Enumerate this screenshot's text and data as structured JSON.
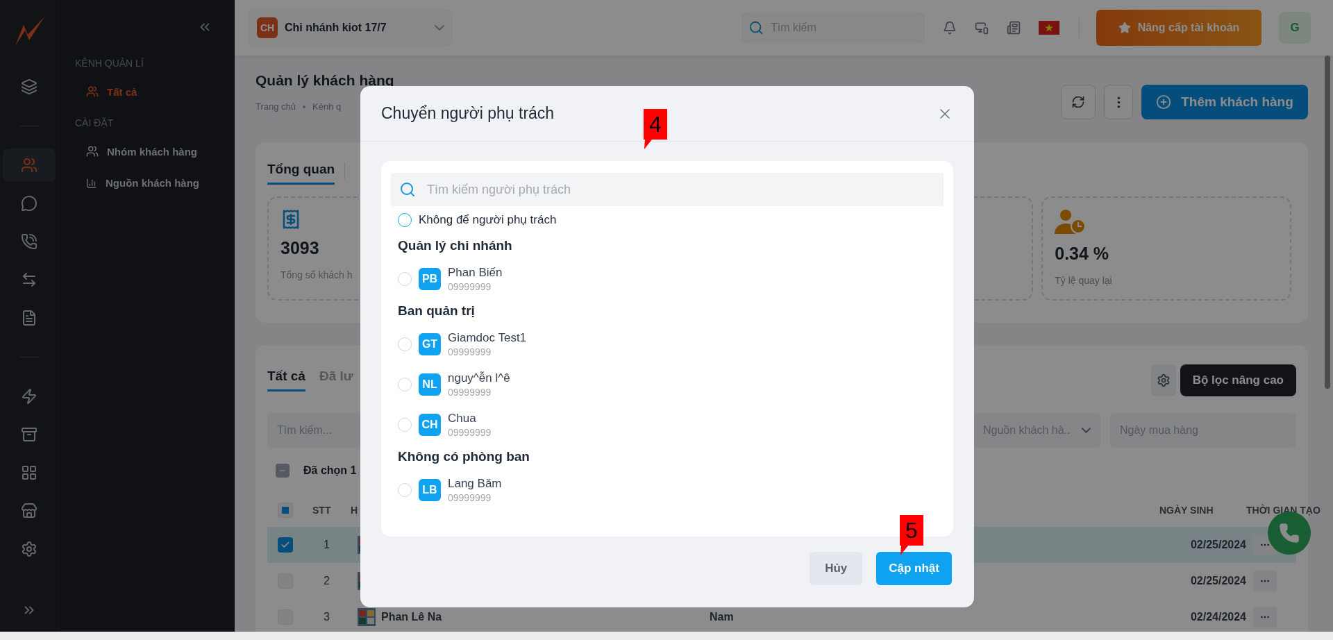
{
  "sidebar": {
    "rail": [
      {
        "kind": "layers",
        "selected": false
      },
      {
        "kind": "divider"
      },
      {
        "kind": "users",
        "selected": true
      },
      {
        "kind": "chat",
        "selected": false
      },
      {
        "kind": "phone",
        "selected": false
      },
      {
        "kind": "money",
        "selected": false
      },
      {
        "kind": "document",
        "selected": false
      },
      {
        "kind": "divider"
      },
      {
        "kind": "automation",
        "selected": false
      },
      {
        "kind": "archive",
        "selected": false
      },
      {
        "kind": "apps",
        "selected": false
      },
      {
        "kind": "store",
        "selected": false
      },
      {
        "kind": "settings",
        "selected": false
      }
    ],
    "sections": [
      {
        "title": "KÊNH QUẢN LÍ",
        "items": [
          {
            "label": "Tất cả",
            "kind": "users",
            "selected": true
          }
        ]
      },
      {
        "title": "CÀI ĐẶT",
        "items": [
          {
            "label": "Nhóm khách hàng",
            "kind": "users",
            "selected": false
          },
          {
            "label": "Nguồn khách hàng",
            "kind": "chart",
            "selected": false
          }
        ]
      }
    ]
  },
  "topbar": {
    "branch": {
      "badge": "CH",
      "name": "Chi nhánh kiot 17/7"
    },
    "search": {
      "placeholder": "Tìm kiếm"
    },
    "upgrade_button": "Nâng cấp tài khoản",
    "avatar": "G"
  },
  "page": {
    "title": "Quản lý khách hàng",
    "breadcrumb": [
      "Trang chủ",
      "Kênh q"
    ],
    "add_button": "Thêm khách hàng"
  },
  "overview": {
    "tabs": [
      {
        "label": "Tổng quan",
        "selected": true
      }
    ],
    "stats": [
      {
        "kind": "receipt",
        "value": "3093",
        "label": "Tổng số khách h"
      },
      {
        "kind": "blank"
      },
      {
        "kind": "returning",
        "value": "0.34 %",
        "label": "Tỷ lệ quay lại"
      }
    ]
  },
  "customers": {
    "tabs": [
      {
        "label": "Tất cả",
        "selected": true
      },
      {
        "label": "Đã lư",
        "selected": false
      }
    ],
    "filter_button": "Bộ lọc nâng cao",
    "filters": [
      {
        "kind": "search",
        "placeholder": "Tìm kiếm..."
      },
      {
        "kind": "select",
        "placeholder": "Nguồn khách hà.."
      },
      {
        "kind": "date",
        "placeholder": "Ngày mua hàng"
      }
    ],
    "bulk": {
      "label": "Đã chọn 1",
      "partial": true
    },
    "header_checkbox": {
      "partial": true
    },
    "columns": [
      "STT",
      "H",
      "",
      "",
      "NGÀY SINH",
      "THỜI GIAN TẠO"
    ],
    "rows": [
      {
        "checked": true,
        "stt": "1",
        "created": "02/25/2024"
      },
      {
        "checked": false,
        "stt": "2",
        "created": "02/25/2024"
      },
      {
        "checked": false,
        "stt": "3",
        "name": "Phan Lê Na",
        "gender": "Nam",
        "created": "02/24/2024"
      }
    ]
  },
  "modal": {
    "title": "Chuyển người phụ trách",
    "search": {
      "placeholder": "Tìm kiếm người phụ trách"
    },
    "options": [
      {
        "label": "Không để người phụ trách",
        "selected": false
      }
    ],
    "groups": [
      {
        "title": "Quản lý chi nhánh",
        "members": [
          {
            "initials": "PB",
            "name": "Phan Biến",
            "phone": "09999999",
            "selected": false
          }
        ]
      },
      {
        "title": "Ban quản trị",
        "members": [
          {
            "initials": "GT",
            "name": "Giamdoc Test1",
            "phone": "09999999",
            "selected": false
          },
          {
            "initials": "NL",
            "name": "nguy^ễn l^ê",
            "phone": "09999999",
            "selected": false
          },
          {
            "initials": "CH",
            "name": "Chua",
            "phone": "09999999",
            "selected": false
          }
        ]
      },
      {
        "title": "Không có phòng ban",
        "members": [
          {
            "initials": "LB",
            "name": "Lang Băm",
            "phone": "09999999",
            "selected": false
          }
        ]
      }
    ],
    "buttons": [
      {
        "kind": "secondary",
        "label": "Hủy"
      },
      {
        "kind": "primary",
        "label": "Cập nhật"
      }
    ]
  },
  "annotations": [
    {
      "label": "4"
    },
    {
      "label": "5"
    }
  ]
}
